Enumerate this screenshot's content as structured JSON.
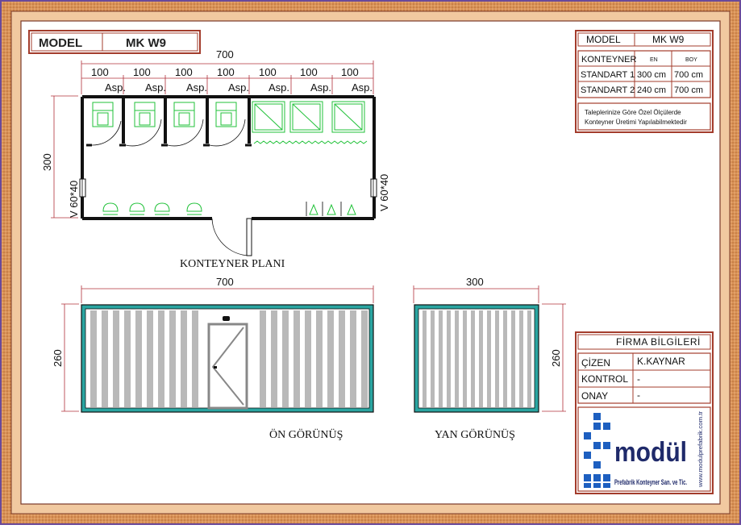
{
  "title_block": {
    "model_label": "MODEL",
    "model_value": "MK W9"
  },
  "plan": {
    "total_width": "700",
    "modules": [
      "100",
      "100",
      "100",
      "100",
      "100",
      "100",
      "100"
    ],
    "asp_label": "Asp.",
    "depth": "300",
    "window_left": "V 60*40",
    "window_right": "V 60*40",
    "caption": "KONTEYNER PLANI"
  },
  "front_view": {
    "width": "700",
    "height": "260",
    "caption": "ÖN  GÖRÜNÜŞ"
  },
  "side_view": {
    "width": "300",
    "height": "260",
    "caption": "YAN  GÖRÜNÜŞ"
  },
  "spec_table": {
    "model_label": "MODEL",
    "model_value": "MK W9",
    "header_container": "KONTEYNER",
    "header_width": "EN",
    "header_length": "BOY",
    "rows": [
      {
        "name": "STANDART 1",
        "width": "300 cm",
        "length": "700 cm"
      },
      {
        "name": "STANDART 2",
        "width": "240 cm",
        "length": "700 cm"
      }
    ],
    "note_line1": "Taleplerinize Göre Özel Ölçülerde",
    "note_line2": "Konteyner Üretimi Yapılabilmektedir"
  },
  "firm": {
    "title": "FİRMA BİLGİLERİ",
    "rows": [
      {
        "label": "ÇİZEN",
        "value": "K.KAYNAR"
      },
      {
        "label": "KONTROL",
        "value": "-"
      },
      {
        "label": "ONAY",
        "value": "-"
      }
    ],
    "logo_text": "modül",
    "logo_sub": "Prefabrik Konteyner San. ve Tic.",
    "logo_url": "www.modulprefabrik.com.tr"
  },
  "colors": {
    "frame_outer": "#c98a4a",
    "frame_inner": "#e8b98c",
    "table_border": "#a33c2c",
    "teal": "#2aa5a1",
    "fixture_green": "#22c23a",
    "logo_blue": "#1d5fc0"
  }
}
